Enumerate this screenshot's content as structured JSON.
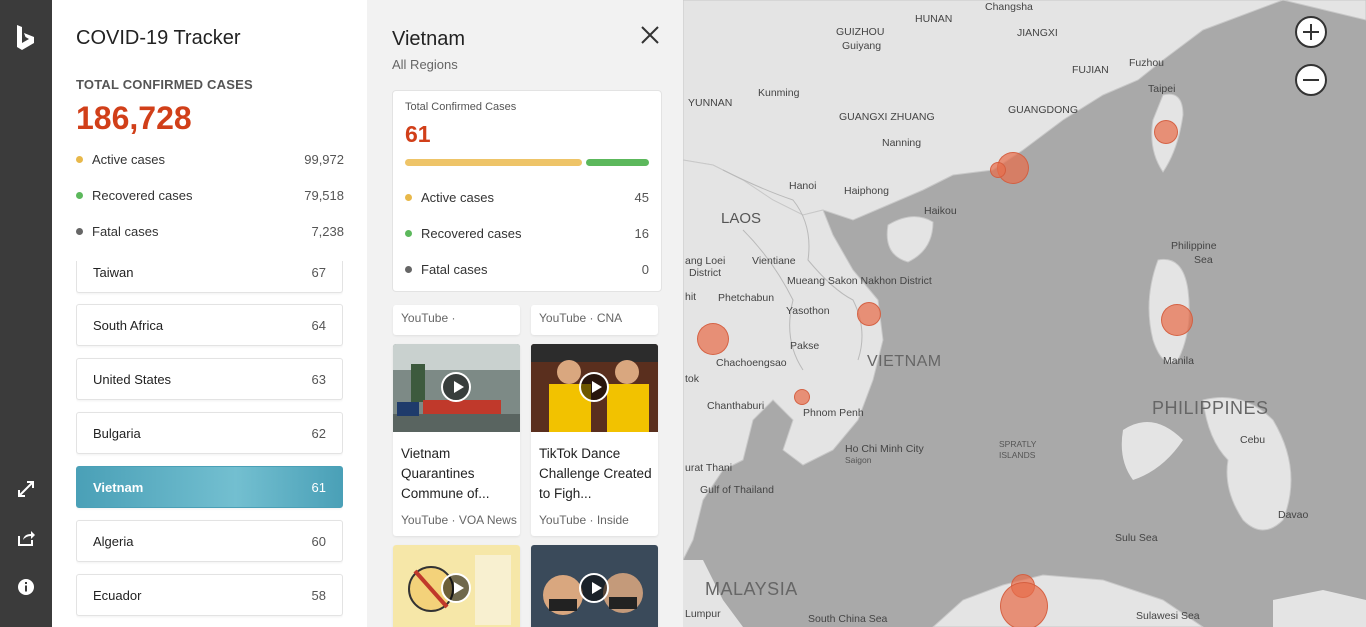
{
  "app": {
    "title": "COVID-19 Tracker",
    "total_label": "TOTAL CONFIRMED CASES",
    "total_value": "186,728",
    "stats": [
      {
        "label": "Active cases",
        "value": "99,972",
        "color": "#e8b84a"
      },
      {
        "label": "Recovered cases",
        "value": "79,518",
        "color": "#5cb85c"
      },
      {
        "label": "Fatal cases",
        "value": "7,238",
        "color": "#666666"
      }
    ]
  },
  "countries": [
    {
      "name": "Taiwan",
      "value": "67"
    },
    {
      "name": "South Africa",
      "value": "64"
    },
    {
      "name": "United States",
      "value": "63"
    },
    {
      "name": "Bulgaria",
      "value": "62"
    },
    {
      "name": "Vietnam",
      "value": "61",
      "selected": true
    },
    {
      "name": "Algeria",
      "value": "60"
    },
    {
      "name": "Ecuador",
      "value": "58"
    }
  ],
  "detail": {
    "name": "Vietnam",
    "subtitle": "All Regions",
    "card_label": "Total Confirmed Cases",
    "card_value": "61",
    "active_fraction": 0.738,
    "stats": [
      {
        "label": "Active cases",
        "value": "45",
        "color": "#e8b84a"
      },
      {
        "label": "Recovered cases",
        "value": "16",
        "color": "#5cb85c"
      },
      {
        "label": "Fatal cases",
        "value": "0",
        "color": "#666666"
      }
    ],
    "videos_partial": [
      {
        "source": "YouTube ·"
      },
      {
        "source": "YouTube · CNA"
      }
    ],
    "videos": [
      {
        "title": "Vietnam Quarantines Commune of...",
        "source": "YouTube · VOA News"
      },
      {
        "title": "TikTok Dance Challenge Created to Figh...",
        "source": "YouTube · Inside"
      }
    ]
  },
  "map": {
    "labels": {
      "guizhou": "GUIZHOU",
      "guiyang": "Guiyang",
      "hunan": "HUNAN",
      "changsha": "Changsha",
      "jiangxi": "JIANGXI",
      "fujian": "FUJIAN",
      "fuzhou": "Fuzhou",
      "yunnan": "YUNNAN",
      "kunming": "Kunming",
      "guangxi": "GUANGXI ZHUANG",
      "guangdong": "GUANGDONG",
      "taipei": "Taipei",
      "nanning": "Nanning",
      "hanoi": "Hanoi",
      "haiphong": "Haiphong",
      "haikou": "Haikou",
      "laos": "LAOS",
      "luang": "ang Loei",
      "district": "District",
      "vientiane": "Vientiane",
      "philippine_sea_1": "Philippine",
      "philippine_sea_2": "Sea",
      "mueang": "Mueang Sakon Nakhon District",
      "hit": "hit",
      "phetchabun": "Phetchabun",
      "yasothon": "Yasothon",
      "vietnam": "VIETNAM",
      "pakse": "Pakse",
      "manila": "Manila",
      "chachoengsao": "Chachoengsao",
      "tok": "tok",
      "chanthaburi": "Chanthaburi",
      "phnom_penh": "Phnom Penh",
      "philippines": "PHILIPPINES",
      "spratly_1": "SPRATLY",
      "spratly_2": "ISLANDS",
      "hcmc": "Ho Chi Minh City",
      "saigon": "Saigon",
      "cebu": "Cebu",
      "urat_thani": "urat Thani",
      "gulf_thailand": "Gulf of Thailand",
      "davao": "Davao",
      "sulu_sea": "Sulu Sea",
      "malaysia": "MALAYSIA",
      "lumpur": "Lumpur",
      "south_china_sea": "South China Sea",
      "sulawesi_sea": "Sulawesi Sea"
    }
  },
  "icons": [
    "bing-logo-icon",
    "expand-icon",
    "share-icon",
    "info-icon",
    "close-icon",
    "zoom-in-icon",
    "zoom-out-icon",
    "play-icon"
  ]
}
